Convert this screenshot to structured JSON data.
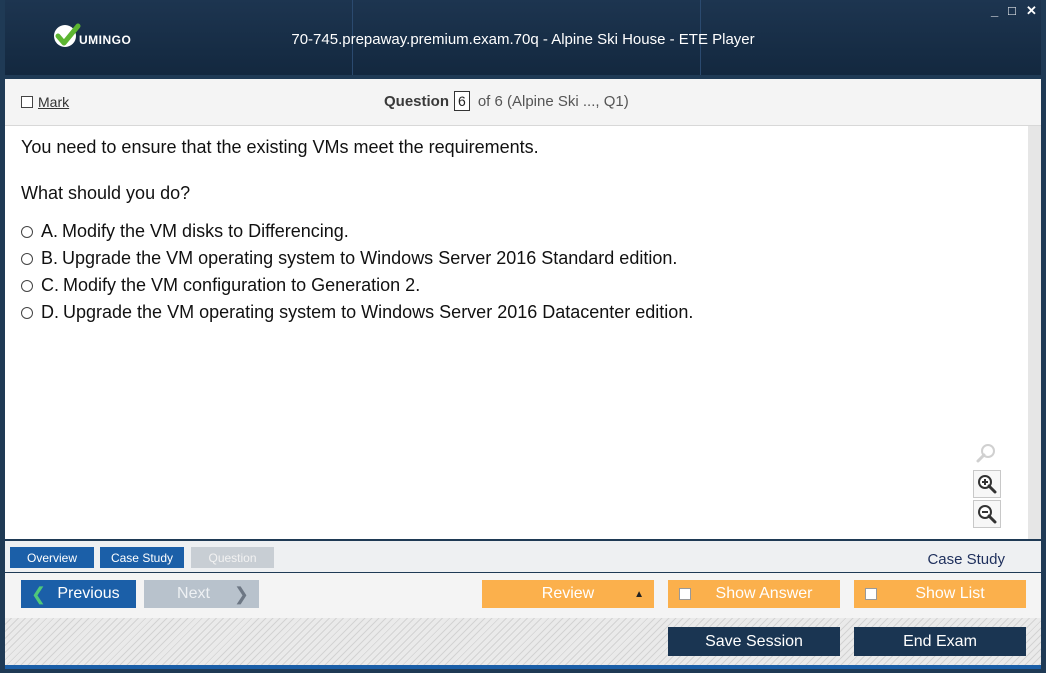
{
  "window": {
    "title": "70-745.prepaway.premium.exam.70q - Alpine Ski House - ETE Player",
    "logo_text": "UMINGO",
    "controls": [
      "_",
      "□",
      "✕"
    ]
  },
  "question_bar": {
    "mark_label": "Mark",
    "question_label": "Question",
    "question_number": "6",
    "of_text": "of 6 (Alpine Ski ..., Q1)"
  },
  "question": {
    "stem": "You need to ensure that the existing VMs meet the requirements.",
    "prompt": "What should you do?",
    "options": [
      {
        "letter": "A.",
        "text": "Modify the VM disks to Differencing."
      },
      {
        "letter": "B.",
        "text": "Upgrade the VM operating system to Windows Server 2016 Standard edition."
      },
      {
        "letter": "C.",
        "text": "Modify the VM configuration to Generation 2."
      },
      {
        "letter": "D.",
        "text": "Upgrade the VM operating system to Windows Server 2016 Datacenter edition."
      }
    ]
  },
  "zoom": [
    "search-icon",
    "zoom-in-icon",
    "zoom-out-icon"
  ],
  "tabs": {
    "overview": "Overview",
    "case_study": "Case Study",
    "question": "Question",
    "section_label": "Case Study"
  },
  "nav": {
    "previous": "Previous",
    "next": "Next",
    "review": "Review",
    "show_answer": "Show Answer",
    "show_list": "Show List",
    "save_session": "Save Session",
    "end_exam": "End Exam"
  },
  "colors": {
    "titlebar": "#1d3550",
    "primary_button": "#1b5fa8",
    "disabled_button": "#b8c2cc",
    "orange_button": "#fbb04c",
    "dark_button": "#1a3552",
    "case_study_text": "#1e2f5c"
  }
}
